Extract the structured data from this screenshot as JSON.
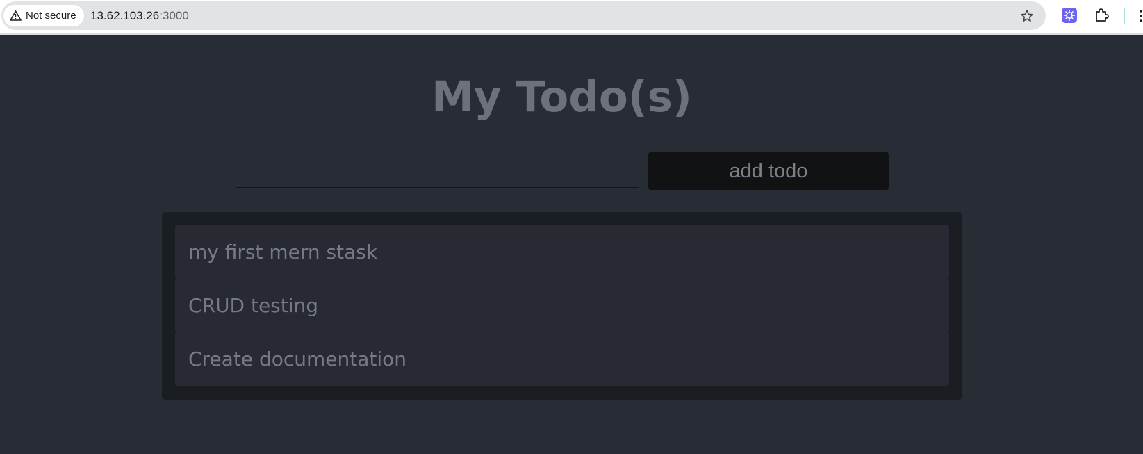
{
  "browser": {
    "security_label": "Not secure",
    "url_host": "13.62.103.26",
    "url_port": ":3000",
    "icons": {
      "security": "warning-triangle-icon",
      "bookmark": "star-icon",
      "extension_1": "extension-badge-icon",
      "extension_2": "puzzle-piece-icon",
      "menu": "kebab-menu-icon"
    }
  },
  "app": {
    "title": "My Todo(s)",
    "input": {
      "value": "",
      "placeholder": ""
    },
    "add_button_label": "add todo",
    "todos": [
      {
        "text": "my first mern stask"
      },
      {
        "text": "CRUD testing"
      },
      {
        "text": "Create documentation"
      }
    ]
  },
  "colors": {
    "background": "#282c34",
    "panel": "#1a1d22",
    "item": "#272a33",
    "button": "#111214",
    "title_text": "#6e7179",
    "item_text": "#777a82",
    "extension_badge": "#6c63f0"
  }
}
